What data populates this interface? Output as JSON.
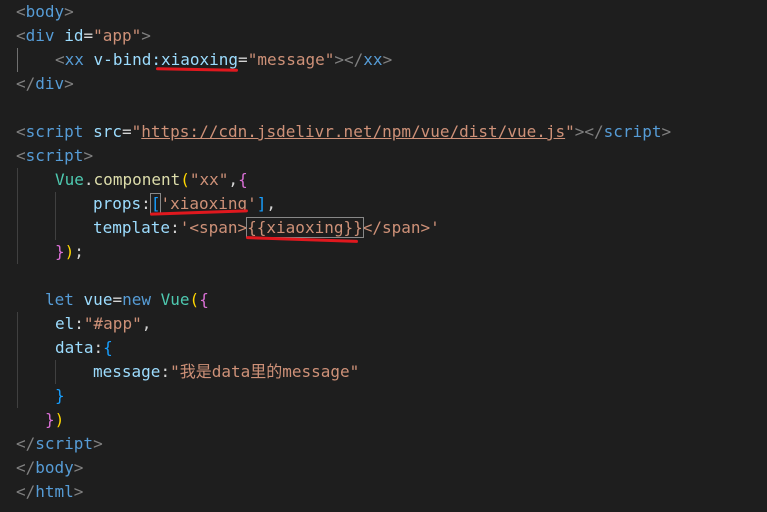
{
  "colors": {
    "background": "#1e1e1e",
    "tag": "#569cd6",
    "attribute": "#9cdcfe",
    "string": "#ce9178",
    "annotation": "#e0181e"
  },
  "code": {
    "l1": {
      "open": "<",
      "tag": "body",
      "close": ">"
    },
    "l2": {
      "open": "<",
      "tag": "div",
      "attr": "id",
      "eq": "=",
      "val": "\"app\"",
      "close": ">"
    },
    "l3": {
      "open": "<",
      "tag": "xx",
      "attr": "v-bind:xiaoxing",
      "eq": "=",
      "val": "\"message\"",
      "close": "></",
      "end_tag": "xx",
      "end_close": ">"
    },
    "l4": {
      "open": "</",
      "tag": "div",
      "close": ">"
    },
    "l6": {
      "open": "<",
      "tag": "script",
      "attr": "src",
      "eq": "=",
      "val_q1": "\"",
      "url": "https://cdn.jsdelivr.net/npm/vue/dist/vue.js",
      "val_q2": "\"",
      "close": "></",
      "end_tag": "script",
      "end_close": ">"
    },
    "l7": {
      "open": "<",
      "tag": "script",
      "close": ">"
    },
    "l8": {
      "obj": "Vue",
      "dot": ".",
      "fn": "component",
      "paren": "(",
      "str": "\"xx\"",
      "comma": ",",
      "brace": "{"
    },
    "l9": {
      "key": "props",
      "colon": ":",
      "open": "[",
      "str": "'xiaoxing'",
      "close": "]",
      "comma": ","
    },
    "l10": {
      "key": "template",
      "colon": ":",
      "str_a": "'<span>",
      "mustache": "{{xiaoxing}}",
      "str_b": "</span>'"
    },
    "l11": {
      "brace": "}",
      "paren": ")",
      "semi": ";"
    },
    "l13": {
      "kw1": "let",
      "var": "vue",
      "eq": "=",
      "kw2": "new",
      "cls": "Vue",
      "paren": "(",
      "brace": "{"
    },
    "l14": {
      "key": "el",
      "colon": ":",
      "str": "\"#app\"",
      "comma": ","
    },
    "l15": {
      "key": "data",
      "colon": ":",
      "brace": "{"
    },
    "l16": {
      "key": "message",
      "colon": ":",
      "str": "\"我是data里的message\""
    },
    "l17": {
      "brace": "}"
    },
    "l18": {
      "brace": "}",
      "paren": ")"
    },
    "l19": {
      "open": "</",
      "tag": "script",
      "close": ">"
    },
    "l20": {
      "open": "</",
      "tag": "body",
      "close": ">"
    },
    "l21": {
      "open": "</",
      "tag": "html",
      "close": ">"
    }
  }
}
